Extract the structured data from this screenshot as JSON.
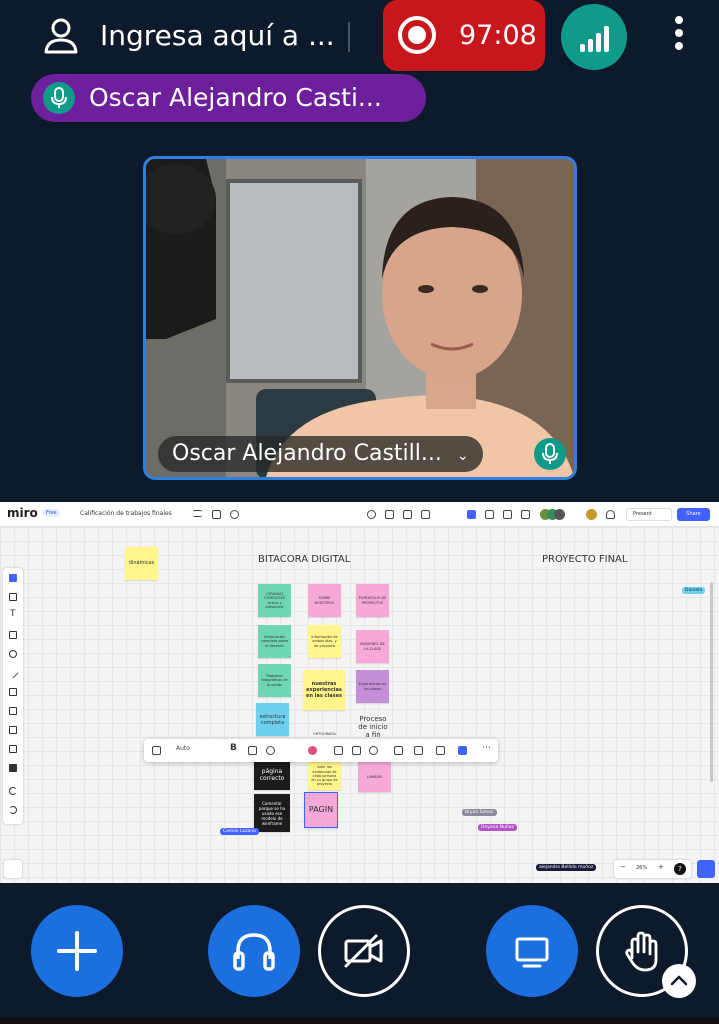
{
  "header": {
    "room_title": "Ingresa aquí a ...",
    "recording_time": "97:08"
  },
  "speaker": {
    "name": "Oscar Alejandro Casti..."
  },
  "video": {
    "participant_label": "Oscar Alejandro Castill..."
  },
  "miro": {
    "logo": "miro",
    "plan_badge": "Free",
    "board_name": "Calificación de trabajos finales",
    "present_label": "Present",
    "share_label": "Share",
    "frames": {
      "bitacora": "BITACORA DIGITAL",
      "proyecto": "PROYECTO FINAL"
    },
    "stickies": {
      "dinamicas": "dinámicas",
      "s1": "(GRAVAS) COMPLETAS virtual y presencial",
      "s2": "SOBRE NOSOTROS",
      "s3": "PORTAFOLIO DE PROYECTOS",
      "s4": "Información completa sobre el docente",
      "s5": "Información de ambos días, y de proyecto",
      "s6": "IMÁGENES DE LA CLASE",
      "s7": "Registros fotográficos de la sesión",
      "s8": "nuestras experiencias en las clases",
      "s9": "Experiencias en las clases",
      "s10": "estructura completa",
      "s11": "ORTOGRAFÍA",
      "s12": "Proceso de inicio a fin",
      "s13": "página correcto",
      "s14": "subir las evidencias de cada persona en su grupo de proyecto",
      "s15": "LINKEAR",
      "s16": "Comentar porque se ha usado ese modelo de wireframe",
      "s17": "PAGIN"
    },
    "cursors": {
      "daniela": "Daniela",
      "bryan": "Bryan Simon",
      "dayana": "Dayana Nuñez",
      "camilo": "Camilo Lozano",
      "alejandro": "alejandro Bellido muñoz"
    },
    "font_size_label": "Auto",
    "zoom_label": "26%"
  },
  "colors": {
    "background": "#0c1a2b",
    "recording": "#c8161d",
    "teal": "#0f9a8a",
    "speaker_pill": "#6d1f9c",
    "action_blue": "#1b6fde",
    "active_border": "#2f7fe0"
  },
  "icons": {
    "user": "user-icon",
    "record": "record-icon",
    "signal": "connection-status-icon",
    "menu": "more-vertical-icon",
    "mic": "microphone-icon",
    "plus": "plus-icon",
    "headphones": "headphones-icon",
    "camera_off": "camera-off-icon",
    "screen": "screen-share-icon",
    "hand": "raise-hand-icon",
    "chevron_up": "chevron-up-icon"
  }
}
